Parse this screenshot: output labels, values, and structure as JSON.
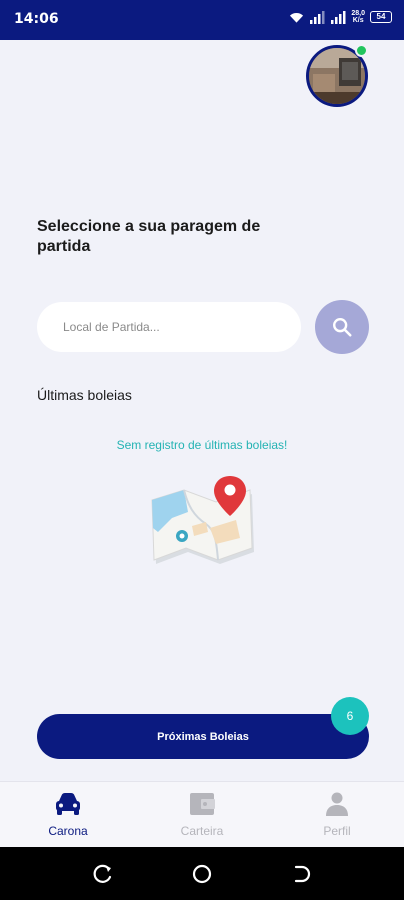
{
  "status_bar": {
    "time": "14:06",
    "speed_value": "28,0",
    "speed_unit": "K/s",
    "battery": "54",
    "icons": [
      "wifi-icon",
      "signal-icon",
      "signal-icon",
      "battery-icon"
    ]
  },
  "profile": {
    "avatar_icon": "user-photo",
    "online": true
  },
  "heading": "Seleccione a sua paragem de partida",
  "search": {
    "placeholder": "Local de Partida...",
    "value": "",
    "icon": "search-icon"
  },
  "recent": {
    "title": "Últimas boleias",
    "empty_message": "Sem registro de últimas boleias!",
    "illustration": "map-pin-illustration"
  },
  "next_rides": {
    "label": "Próximas Boleias",
    "count": "6"
  },
  "bottom_nav": {
    "items": [
      {
        "label": "Carona",
        "icon": "car-icon",
        "active": true
      },
      {
        "label": "Carteira",
        "icon": "wallet-icon",
        "active": false
      },
      {
        "label": "Perfil",
        "icon": "person-icon",
        "active": false
      }
    ]
  },
  "system_nav": [
    "recent-apps-icon",
    "home-icon",
    "back-icon"
  ],
  "colors": {
    "primary": "#0b1a80",
    "accent": "#1cc2bd",
    "search_button": "#a5a8d7",
    "background": "#f1f2f9",
    "inactive": "#b5b5bb"
  }
}
